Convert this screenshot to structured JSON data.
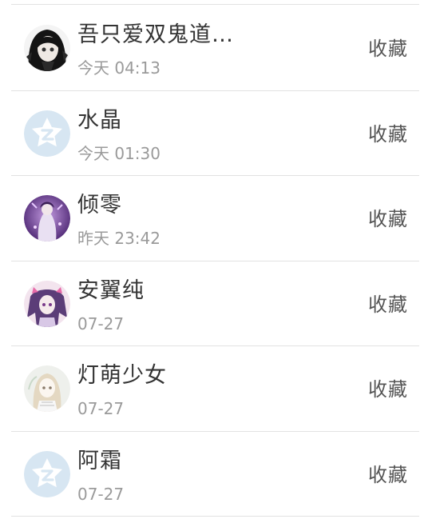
{
  "contacts": [
    {
      "name": "吾只爱双鬼道…",
      "time": "今天 04:13",
      "action": "收藏",
      "avatar_icon": "anime-avatar-dark"
    },
    {
      "name": "水晶",
      "time": "今天 01:30",
      "action": "收藏",
      "avatar_icon": "default-qq-star-avatar"
    },
    {
      "name": "倾零",
      "time": "昨天 23:42",
      "action": "收藏",
      "avatar_icon": "anime-avatar-purple"
    },
    {
      "name": "安翼纯",
      "time": "07-27",
      "action": "收藏",
      "avatar_icon": "anime-avatar-pink"
    },
    {
      "name": "灯萌少女",
      "time": "07-27",
      "action": "收藏",
      "avatar_icon": "anime-avatar-light"
    },
    {
      "name": "阿霜",
      "time": "07-27",
      "action": "收藏",
      "avatar_icon": "default-qq-star-avatar"
    }
  ],
  "colors": {
    "default_avatar": "#d7e6f2",
    "divider": "#e2e2e2",
    "name_text": "#333333",
    "time_text": "#9a9a9a"
  }
}
